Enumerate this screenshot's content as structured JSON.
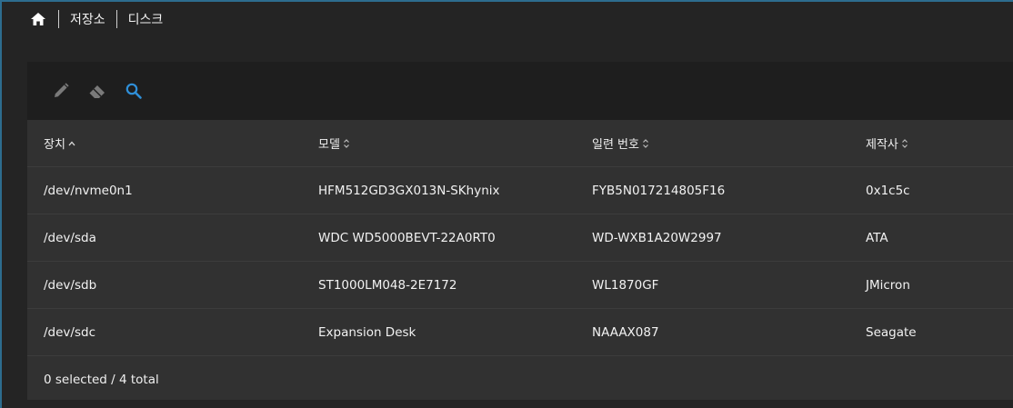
{
  "breadcrumb": {
    "home_icon": "home-icon",
    "items": [
      "저장소",
      "디스크"
    ]
  },
  "toolbar": {
    "icons": [
      "pencil-icon",
      "eraser-icon",
      "search-icon"
    ],
    "accent_color": "#2f8fd8"
  },
  "table": {
    "columns": [
      {
        "label": "장치",
        "sort": "ascending"
      },
      {
        "label": "모델",
        "sort": "none"
      },
      {
        "label": "일련 번호",
        "sort": "none"
      },
      {
        "label": "제작사",
        "sort": "none"
      }
    ],
    "rows": [
      [
        "/dev/nvme0n1",
        "HFM512GD3GX013N-SKhynix",
        "FYB5N017214805F16",
        "0x1c5c"
      ],
      [
        "/dev/sda",
        "WDC WD5000BEVT-22A0RT0",
        "WD-WXB1A20W2997",
        "ATA"
      ],
      [
        "/dev/sdb",
        "ST1000LM048-2E7172",
        "WL1870GF",
        "JMicron"
      ],
      [
        "/dev/sdc",
        "Expansion Desk",
        "NAAAX087",
        "Seagate"
      ]
    ]
  },
  "footer": {
    "status": "0 selected / 4 total"
  }
}
